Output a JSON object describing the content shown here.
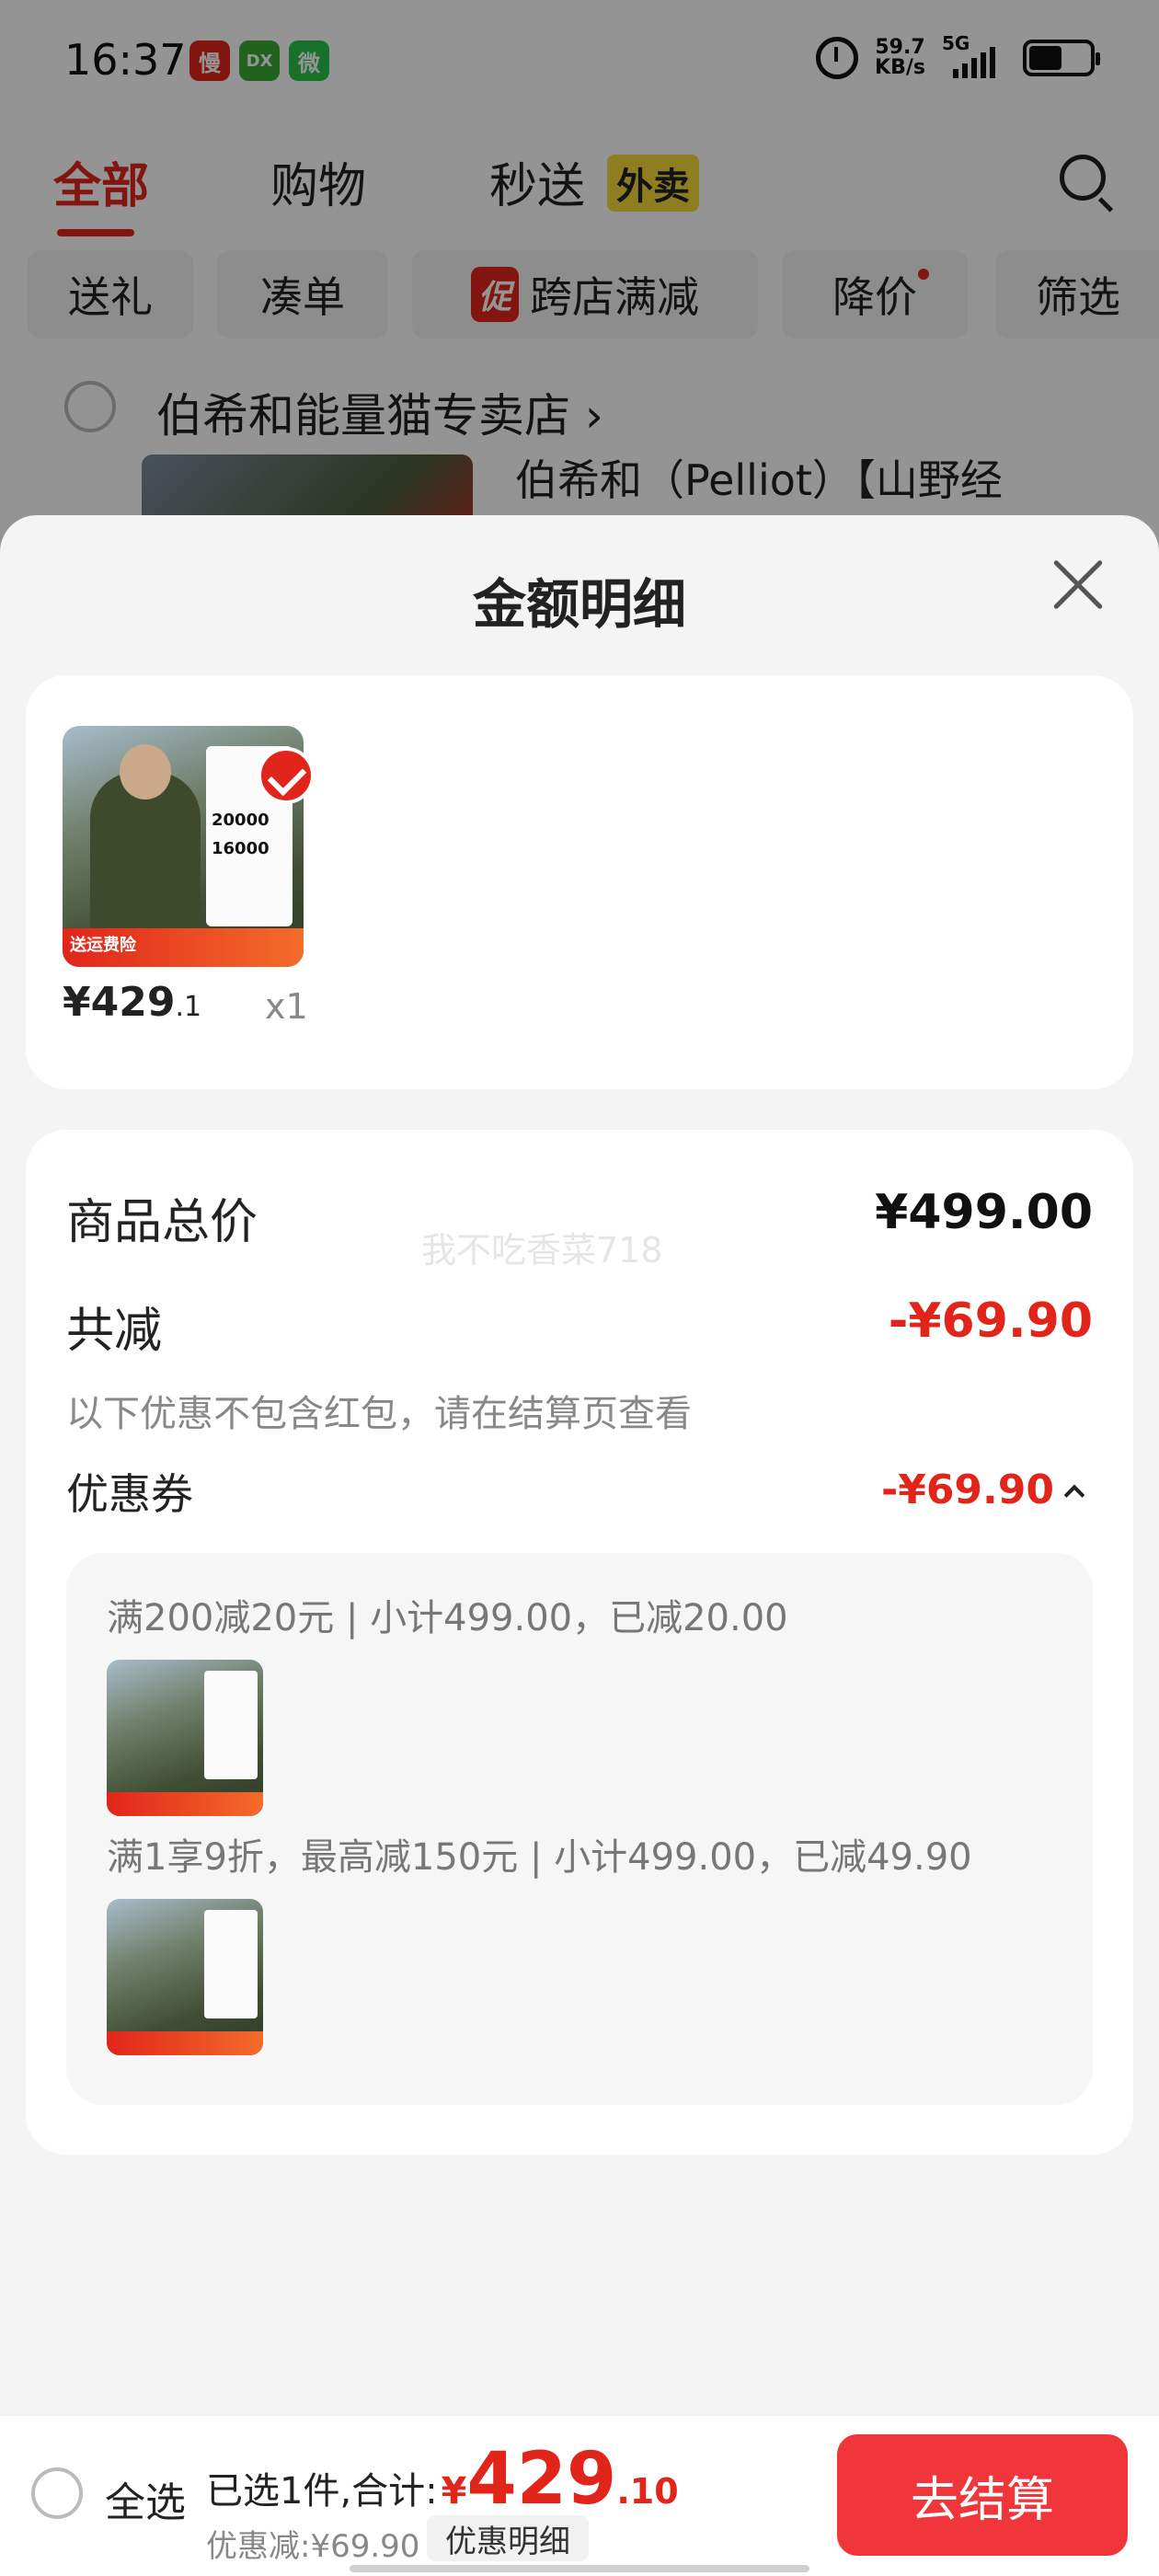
{
  "status_bar": {
    "time": "16:37",
    "net_speed_value": "59.7",
    "net_speed_unit": "KB/s",
    "network": "5G",
    "apps": [
      {
        "name": "慢",
        "color": "#e1251b"
      },
      {
        "name": "DX",
        "color": "#3aa935"
      },
      {
        "name": "微",
        "color": "#2bc14a"
      }
    ]
  },
  "top_tabs": {
    "tabs": [
      "全部",
      "购物",
      "秒送"
    ],
    "active_index": 0,
    "waimai_tag": "外卖"
  },
  "filters": [
    "送礼",
    "凑单",
    "跨店满减",
    "降价",
    "筛选"
  ],
  "promo_mark": "促",
  "store": {
    "name": "伯希和能量猫专卖店 ›",
    "product_name": "伯希和（Pelliot）【山野经"
  },
  "sheet": {
    "title": "金额明细"
  },
  "item": {
    "price_main": "¥429",
    "price_cents": ".1",
    "quantity": "x1",
    "image_numbers": [
      "20000",
      "16000"
    ],
    "image_banner": "送运费险"
  },
  "summary": {
    "goods_total_label": "商品总价",
    "goods_total_value": "¥499.00",
    "reduce_label": "共减",
    "reduce_value": "-¥69.90",
    "note": "以下优惠不包含红包，请在结算页查看",
    "watermark": "我不吃香菜718",
    "coupon_label": "优惠券",
    "coupon_value": "-¥69.90"
  },
  "coupons": [
    {
      "text": "满200减20元 | 小计499.00，已减20.00"
    },
    {
      "text": "满1享9折，最高减150元 | 小计499.00，已减49.90"
    }
  ],
  "bottom_bar": {
    "select_all": "全选",
    "selected_text": "已选1件,合计:",
    "currency": "¥",
    "total_main": "429",
    "total_cents": ".10",
    "discount_text": "优惠减:¥69.90",
    "detail_button": "优惠明细",
    "checkout_button": "去结算"
  },
  "colors": {
    "accent": "#e1251b",
    "checkout": "#f0353b"
  }
}
